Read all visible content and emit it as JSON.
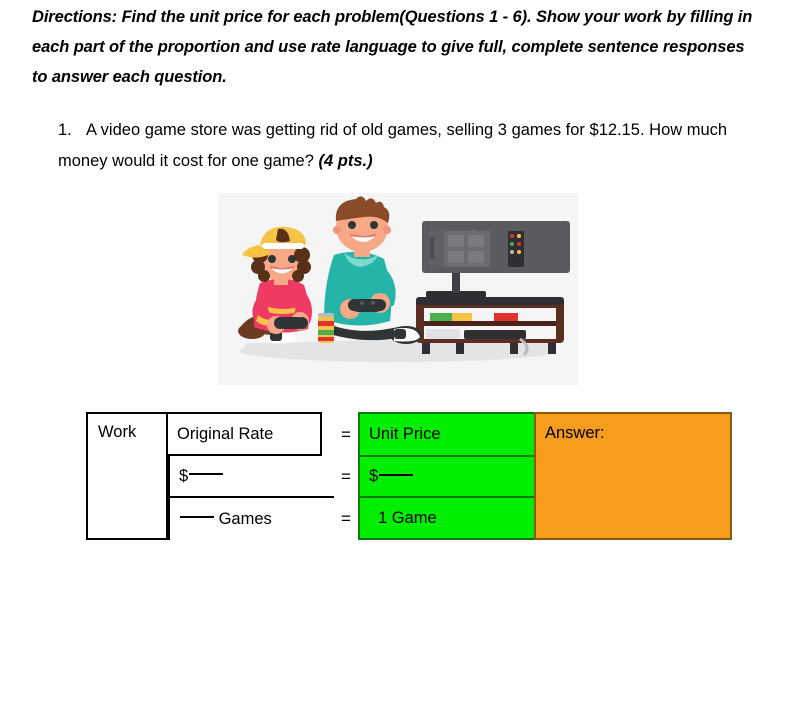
{
  "worksheet": {
    "directions": "Directions: Find the unit price for each problem(Questions 1 - 6). Show your work by filling in each part of the proportion and use rate language to give full, complete sentence responses to answer each question.",
    "question": {
      "number": "1.",
      "text": "A video game store was getting rid of old games, selling 3 games for $12.15. How much money would it cost for one game?",
      "points": "(4 pts.)"
    },
    "illustration": {
      "name": "two-kids-playing-video-games-illustration",
      "background_color": "#f5f5f6",
      "elements": [
        "boy-with-teal-shirt-holding-controller",
        "child-with-yellow-cap-and-pink-shirt",
        "flat-screen-television",
        "wooden-tv-stand-with-shelves",
        "soda-can",
        "game-controllers",
        "sneakers",
        "books-on-shelf",
        "game-console"
      ]
    },
    "table": {
      "work_label": "Work",
      "original_rate_label": "Original Rate",
      "unit_price_label": "Unit Price",
      "answer_label": "Answer:",
      "equals": [
        "=",
        "=",
        "="
      ],
      "left_numerator": "$",
      "left_denominator": "Games",
      "right_numerator": "$",
      "right_denominator": "1 Game",
      "colors": {
        "unit_price_fill": "#00ee00",
        "unit_price_border": "#0a7a0a",
        "answer_fill": "#f79c1c",
        "answer_border": "#8a5a10",
        "table_border": "#000000"
      }
    }
  }
}
